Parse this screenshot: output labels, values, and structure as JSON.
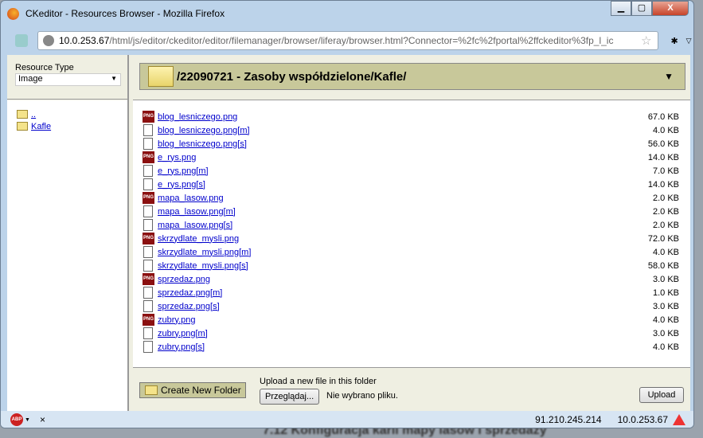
{
  "window": {
    "title": "CKeditor - Resources Browser - Mozilla Firefox",
    "controls": [
      "minimize",
      "maximize",
      "close"
    ]
  },
  "urlbar": {
    "host": "10.0.253.67",
    "path": "/html/js/editor/ckeditor/editor/filemanager/browser/liferay/browser.html?Connector=%2fc%2fportal%2ffckeditor%3fp_l_ic"
  },
  "sidebar": {
    "resource_type_label": "Resource Type",
    "resource_type_value": "Image",
    "tree": [
      {
        "label": ".."
      },
      {
        "label": "Kafle"
      }
    ]
  },
  "header": {
    "path": "/22090721 - Zasoby współdzielone/Kafle/"
  },
  "files": [
    {
      "name": "blog_lesniczego.png",
      "size": "67.0 KB",
      "icon": "png"
    },
    {
      "name": "blog_lesniczego.png[m]",
      "size": "4.0 KB",
      "icon": "file"
    },
    {
      "name": "blog_lesniczego.png[s]",
      "size": "56.0 KB",
      "icon": "file"
    },
    {
      "name": "e_rys.png",
      "size": "14.0 KB",
      "icon": "png"
    },
    {
      "name": "e_rys.png[m]",
      "size": "7.0 KB",
      "icon": "file"
    },
    {
      "name": "e_rys.png[s]",
      "size": "14.0 KB",
      "icon": "file"
    },
    {
      "name": "mapa_lasow.png",
      "size": "2.0 KB",
      "icon": "png"
    },
    {
      "name": "mapa_lasow.png[m]",
      "size": "2.0 KB",
      "icon": "file"
    },
    {
      "name": "mapa_lasow.png[s]",
      "size": "2.0 KB",
      "icon": "file"
    },
    {
      "name": "skrzydlate_mysli.png",
      "size": "72.0 KB",
      "icon": "png"
    },
    {
      "name": "skrzydlate_mysli.png[m]",
      "size": "4.0 KB",
      "icon": "file"
    },
    {
      "name": "skrzydlate_mysli.png[s]",
      "size": "58.0 KB",
      "icon": "file"
    },
    {
      "name": "sprzedaz.png",
      "size": "3.0 KB",
      "icon": "png"
    },
    {
      "name": "sprzedaz.png[m]",
      "size": "1.0 KB",
      "icon": "file"
    },
    {
      "name": "sprzedaz.png[s]",
      "size": "3.0 KB",
      "icon": "file"
    },
    {
      "name": "zubry.png",
      "size": "4.0 KB",
      "icon": "png"
    },
    {
      "name": "zubry.png[m]",
      "size": "3.0 KB",
      "icon": "file"
    },
    {
      "name": "zubry.png[s]",
      "size": "4.0 KB",
      "icon": "file"
    }
  ],
  "bottom": {
    "create_folder": "Create New Folder",
    "upload_label": "Upload a new file in this folder",
    "browse": "Przeglądaj...",
    "no_file": "Nie wybrano pliku.",
    "upload": "Upload"
  },
  "statusbar": {
    "abp": "ABP",
    "close": "×",
    "ip1": "91.210.245.214",
    "ip2": "10.0.253.67"
  },
  "background": {
    "heading": "7.12 Konfiguracja karli mapy lasów i sprzedaży"
  }
}
